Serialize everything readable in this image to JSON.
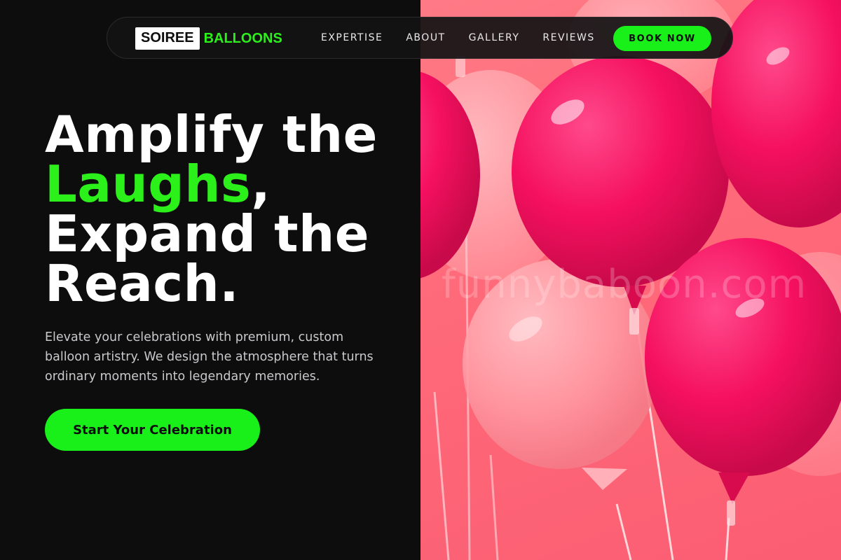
{
  "brand": {
    "name_boxed": "SOIREE",
    "name_accent": "BALLOONS"
  },
  "nav": {
    "links": [
      "EXPERTISE",
      "ABOUT",
      "GALLERY",
      "REVIEWS"
    ],
    "cta_label": "BOOK NOW"
  },
  "hero": {
    "headline_line1": "Amplify the",
    "headline_highlight": "Laughs",
    "headline_comma": ",",
    "headline_line3": "Expand the",
    "headline_line4": "Reach.",
    "subtext": "Elevate your celebrations with premium, custom balloon artistry. We design the atmosphere that turns ordinary moments into legendary memories.",
    "cta_label": "Start Your Celebration",
    "image_watermark": "funnybaboon.com"
  },
  "colors": {
    "background": "#0d0d0e",
    "accent_green": "#19f01a",
    "balloon_magenta": "#f5105f",
    "balloon_pink": "#ff8a97"
  }
}
